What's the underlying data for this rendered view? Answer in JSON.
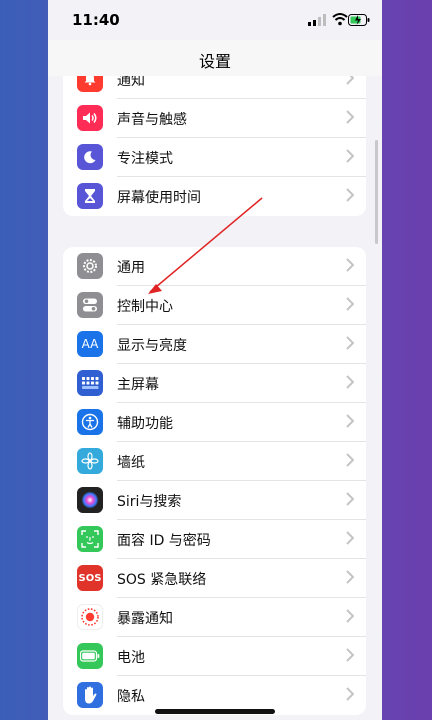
{
  "status_bar": {
    "time": "11:40"
  },
  "nav": {
    "title": "设置"
  },
  "group1": [
    {
      "label": "通知",
      "icon": "bell-icon",
      "color": "#ff3b30"
    },
    {
      "label": "声音与触感",
      "icon": "speaker-icon",
      "color": "#ff2d55"
    },
    {
      "label": "专注模式",
      "icon": "moon-icon",
      "color": "#5856d6"
    },
    {
      "label": "屏幕使用时间",
      "icon": "hourglass-icon",
      "color": "#5856d6"
    }
  ],
  "group2": [
    {
      "label": "通用",
      "icon": "gear-icon",
      "color": "#8e8e93"
    },
    {
      "label": "控制中心",
      "icon": "toggles-icon",
      "color": "#8e8e93"
    },
    {
      "label": "显示与亮度",
      "icon": "aa-icon",
      "icon_text": "AA",
      "color": "#1a73e8"
    },
    {
      "label": "主屏幕",
      "icon": "grid-icon",
      "color": "#2f5fd0"
    },
    {
      "label": "辅助功能",
      "icon": "accessibility-icon",
      "color": "#1a73e8"
    },
    {
      "label": "墙纸",
      "icon": "flower-icon",
      "color": "#34aadc"
    },
    {
      "label": "Siri与搜索",
      "icon": "siri-icon",
      "color": "#222222"
    },
    {
      "label": "面容 ID 与密码",
      "icon": "faceid-icon",
      "color": "#34c759"
    },
    {
      "label": "SOS 紧急联络",
      "icon": "sos-icon",
      "icon_text": "SOS",
      "color": "#e0342b"
    },
    {
      "label": "暴露通知",
      "icon": "exposure-icon",
      "color": "#ffffff"
    },
    {
      "label": "电池",
      "icon": "battery-icon",
      "color": "#34c759"
    },
    {
      "label": "隐私",
      "icon": "hand-icon",
      "color": "#2f6fe0"
    }
  ]
}
